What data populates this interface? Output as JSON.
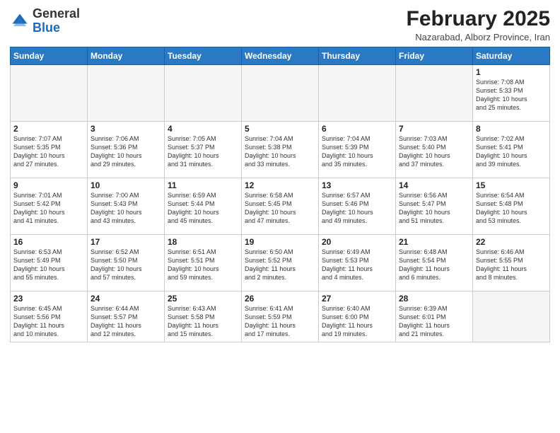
{
  "header": {
    "logo": {
      "line1": "General",
      "line2": "Blue"
    },
    "month_year": "February 2025",
    "location": "Nazarabad, Alborz Province, Iran"
  },
  "days_of_week": [
    "Sunday",
    "Monday",
    "Tuesday",
    "Wednesday",
    "Thursday",
    "Friday",
    "Saturday"
  ],
  "weeks": [
    [
      {
        "day": "",
        "info": ""
      },
      {
        "day": "",
        "info": ""
      },
      {
        "day": "",
        "info": ""
      },
      {
        "day": "",
        "info": ""
      },
      {
        "day": "",
        "info": ""
      },
      {
        "day": "",
        "info": ""
      },
      {
        "day": "1",
        "info": "Sunrise: 7:08 AM\nSunset: 5:33 PM\nDaylight: 10 hours\nand 25 minutes."
      }
    ],
    [
      {
        "day": "2",
        "info": "Sunrise: 7:07 AM\nSunset: 5:35 PM\nDaylight: 10 hours\nand 27 minutes."
      },
      {
        "day": "3",
        "info": "Sunrise: 7:06 AM\nSunset: 5:36 PM\nDaylight: 10 hours\nand 29 minutes."
      },
      {
        "day": "4",
        "info": "Sunrise: 7:05 AM\nSunset: 5:37 PM\nDaylight: 10 hours\nand 31 minutes."
      },
      {
        "day": "5",
        "info": "Sunrise: 7:04 AM\nSunset: 5:38 PM\nDaylight: 10 hours\nand 33 minutes."
      },
      {
        "day": "6",
        "info": "Sunrise: 7:04 AM\nSunset: 5:39 PM\nDaylight: 10 hours\nand 35 minutes."
      },
      {
        "day": "7",
        "info": "Sunrise: 7:03 AM\nSunset: 5:40 PM\nDaylight: 10 hours\nand 37 minutes."
      },
      {
        "day": "8",
        "info": "Sunrise: 7:02 AM\nSunset: 5:41 PM\nDaylight: 10 hours\nand 39 minutes."
      }
    ],
    [
      {
        "day": "9",
        "info": "Sunrise: 7:01 AM\nSunset: 5:42 PM\nDaylight: 10 hours\nand 41 minutes."
      },
      {
        "day": "10",
        "info": "Sunrise: 7:00 AM\nSunset: 5:43 PM\nDaylight: 10 hours\nand 43 minutes."
      },
      {
        "day": "11",
        "info": "Sunrise: 6:59 AM\nSunset: 5:44 PM\nDaylight: 10 hours\nand 45 minutes."
      },
      {
        "day": "12",
        "info": "Sunrise: 6:58 AM\nSunset: 5:45 PM\nDaylight: 10 hours\nand 47 minutes."
      },
      {
        "day": "13",
        "info": "Sunrise: 6:57 AM\nSunset: 5:46 PM\nDaylight: 10 hours\nand 49 minutes."
      },
      {
        "day": "14",
        "info": "Sunrise: 6:56 AM\nSunset: 5:47 PM\nDaylight: 10 hours\nand 51 minutes."
      },
      {
        "day": "15",
        "info": "Sunrise: 6:54 AM\nSunset: 5:48 PM\nDaylight: 10 hours\nand 53 minutes."
      }
    ],
    [
      {
        "day": "16",
        "info": "Sunrise: 6:53 AM\nSunset: 5:49 PM\nDaylight: 10 hours\nand 55 minutes."
      },
      {
        "day": "17",
        "info": "Sunrise: 6:52 AM\nSunset: 5:50 PM\nDaylight: 10 hours\nand 57 minutes."
      },
      {
        "day": "18",
        "info": "Sunrise: 6:51 AM\nSunset: 5:51 PM\nDaylight: 10 hours\nand 59 minutes."
      },
      {
        "day": "19",
        "info": "Sunrise: 6:50 AM\nSunset: 5:52 PM\nDaylight: 11 hours\nand 2 minutes."
      },
      {
        "day": "20",
        "info": "Sunrise: 6:49 AM\nSunset: 5:53 PM\nDaylight: 11 hours\nand 4 minutes."
      },
      {
        "day": "21",
        "info": "Sunrise: 6:48 AM\nSunset: 5:54 PM\nDaylight: 11 hours\nand 6 minutes."
      },
      {
        "day": "22",
        "info": "Sunrise: 6:46 AM\nSunset: 5:55 PM\nDaylight: 11 hours\nand 8 minutes."
      }
    ],
    [
      {
        "day": "23",
        "info": "Sunrise: 6:45 AM\nSunset: 5:56 PM\nDaylight: 11 hours\nand 10 minutes."
      },
      {
        "day": "24",
        "info": "Sunrise: 6:44 AM\nSunset: 5:57 PM\nDaylight: 11 hours\nand 12 minutes."
      },
      {
        "day": "25",
        "info": "Sunrise: 6:43 AM\nSunset: 5:58 PM\nDaylight: 11 hours\nand 15 minutes."
      },
      {
        "day": "26",
        "info": "Sunrise: 6:41 AM\nSunset: 5:59 PM\nDaylight: 11 hours\nand 17 minutes."
      },
      {
        "day": "27",
        "info": "Sunrise: 6:40 AM\nSunset: 6:00 PM\nDaylight: 11 hours\nand 19 minutes."
      },
      {
        "day": "28",
        "info": "Sunrise: 6:39 AM\nSunset: 6:01 PM\nDaylight: 11 hours\nand 21 minutes."
      },
      {
        "day": "",
        "info": ""
      }
    ]
  ]
}
